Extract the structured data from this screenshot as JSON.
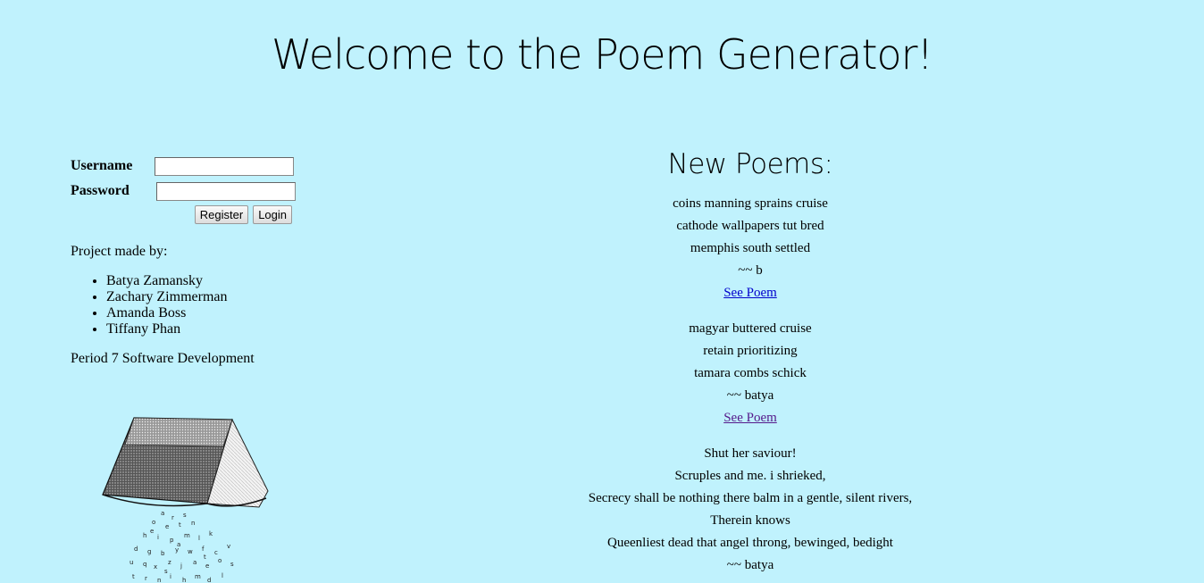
{
  "header": {
    "title": "Welcome to the Poem Generator!"
  },
  "login": {
    "username_label": "Username",
    "password_label": "Password",
    "username_value": "",
    "password_value": "",
    "register_label": "Register",
    "login_label": "Login"
  },
  "credits": {
    "heading": "Project made by:",
    "members": [
      "Batya Zamansky",
      "Zachary Zimmerman",
      "Amanda Boss",
      "Tiffany Phan"
    ],
    "course": "Period 7 Software Development"
  },
  "poems": {
    "heading": "New Poems:",
    "see_label": "See Poem",
    "items": [
      {
        "lines": [
          "coins manning sprains cruise",
          "cathode wallpapers tut bred",
          "memphis south settled"
        ],
        "author": "~~ b"
      },
      {
        "lines": [
          "magyar buttered cruise",
          "retain prioritizing",
          "tamara combs schick"
        ],
        "author": "~~ batya"
      },
      {
        "lines": [
          "Shut her saviour!",
          "Scruples and me. i shrieked,",
          "Secrecy shall be nothing there balm in a gentle, silent rivers,",
          "Therein knows",
          "Queenliest dead that angel throng, bewinged, bedight"
        ],
        "author": "~~ batya"
      }
    ]
  },
  "colors": {
    "background": "#c0f2fd",
    "link": "#0000cc",
    "visited_link": "#551a8b"
  }
}
